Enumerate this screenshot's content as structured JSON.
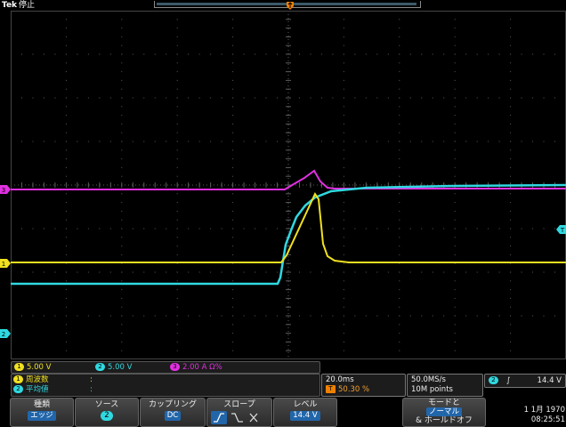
{
  "header": {
    "brand": "Tek",
    "state": "停止"
  },
  "colors": {
    "ch1": "#f0e020",
    "ch2": "#30d8e0",
    "ch3": "#e030e0",
    "trigger": "#f08000",
    "grid": "#5a5a5a"
  },
  "markers": {
    "ch1": "1",
    "ch2": "2",
    "ch3": "3",
    "trigger_level": "T"
  },
  "channels": {
    "ch1": {
      "badge": "1",
      "scale": "5.00 V"
    },
    "ch2": {
      "badge": "2",
      "scale": "5.00 V"
    },
    "ch3": {
      "badge": "3",
      "scale": "2.00 A",
      "impedance": "Ω%"
    }
  },
  "measurements": [
    {
      "badge": "1",
      "label": "周波数",
      "value": ":"
    },
    {
      "badge": "2",
      "label": "平均値",
      "value": ":"
    }
  ],
  "timebase": {
    "scale": "20.0ms",
    "position_badge": "T",
    "position": "50.30 %"
  },
  "acquisition": {
    "rate": "50.0MS/s",
    "length": "10M points"
  },
  "trigger": {
    "source_badge": "2",
    "slope_symbol": "∫",
    "level": "14.4 V"
  },
  "menu": {
    "type": {
      "label": "種類",
      "value": "エッジ"
    },
    "source": {
      "label": "ソース",
      "value": "2"
    },
    "coupling": {
      "label": "カップリング",
      "value": "DC"
    },
    "slope": {
      "label": "スロープ"
    },
    "level": {
      "label": "レベル",
      "value": "14.4 V"
    },
    "mode": {
      "label": "モードと",
      "value": "ノーマル",
      "sub": "& ホールドオフ"
    }
  },
  "clock": {
    "date": "1 1月 1970",
    "time": "08:25:51"
  }
}
